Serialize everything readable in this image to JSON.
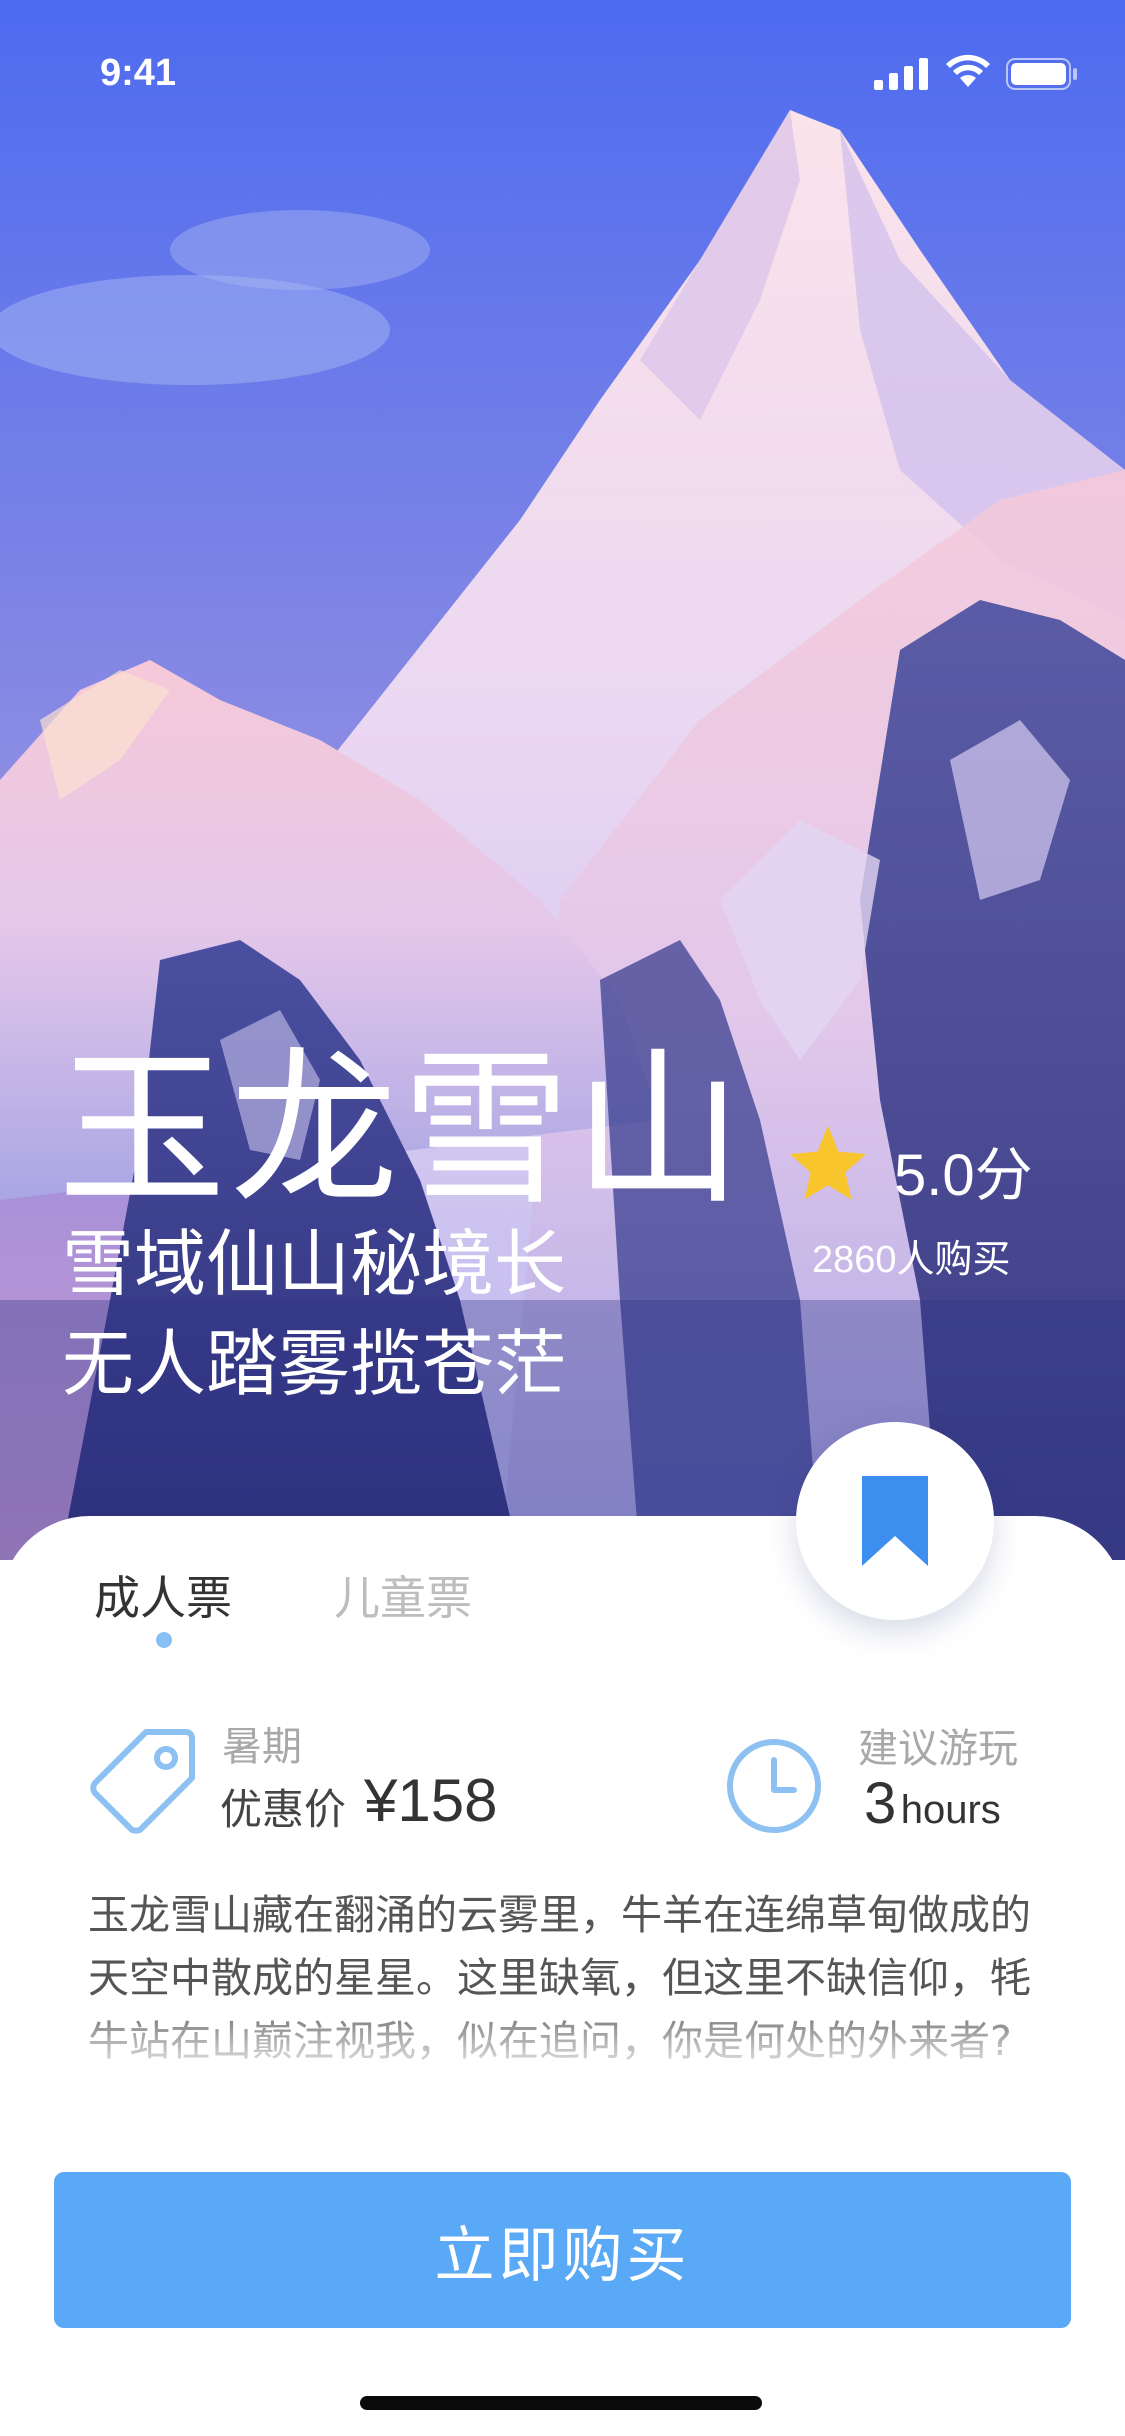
{
  "status_bar": {
    "time": "9:41"
  },
  "hero": {
    "title": "玉龙雪山",
    "subtitle_line1": "雪域仙山秘境长",
    "subtitle_line2": "无人踏雾揽苍茫",
    "rating": "5.0分",
    "buyers": "2860人购买",
    "rating_fraction": 1.0
  },
  "tabs": [
    {
      "label": "成人票",
      "active": true
    },
    {
      "label": "儿童票",
      "active": false
    }
  ],
  "info": {
    "season": "暑期",
    "price_label": "优惠价",
    "price": "¥158",
    "duration_label": "建议游玩",
    "duration_value": "3",
    "duration_unit": "hours"
  },
  "description": "玉龙雪山藏在翻涌的云雾里，牛羊在连绵草甸做成的天空中散成的星星。这里缺氧，但这里不缺信仰，牦牛站在山巅注视我，似在追问，你是何处的外来者?",
  "buy_button": "立即购买",
  "icons": {
    "signal": "signal-icon",
    "wifi": "wifi-icon",
    "battery": "battery-icon",
    "star": "star-icon",
    "bookmark": "bookmark-icon",
    "tag": "tag-icon",
    "clock": "clock-icon"
  },
  "colors": {
    "accent": "#5aa9f7",
    "star": "#f8c52c",
    "tab_indicator": "#88bff4"
  }
}
